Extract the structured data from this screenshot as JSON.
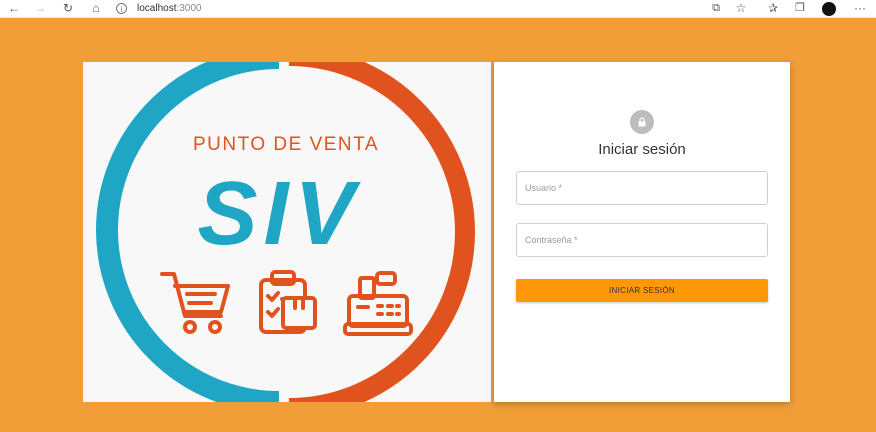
{
  "browser": {
    "url_host": "localhost",
    "url_port": ":3000"
  },
  "logo": {
    "tagline": "PUNTO DE VENTA",
    "brand": "SIV"
  },
  "login": {
    "title": "Iniciar sesión",
    "username_placeholder": "Usuario *",
    "password_placeholder": "Contraseña *",
    "submit_label": "INICIAR SESIÓN"
  },
  "colors": {
    "background": "#f19d38",
    "brand_blue": "#1ea6c4",
    "brand_orange": "#e0531f",
    "button": "#ff9808"
  }
}
